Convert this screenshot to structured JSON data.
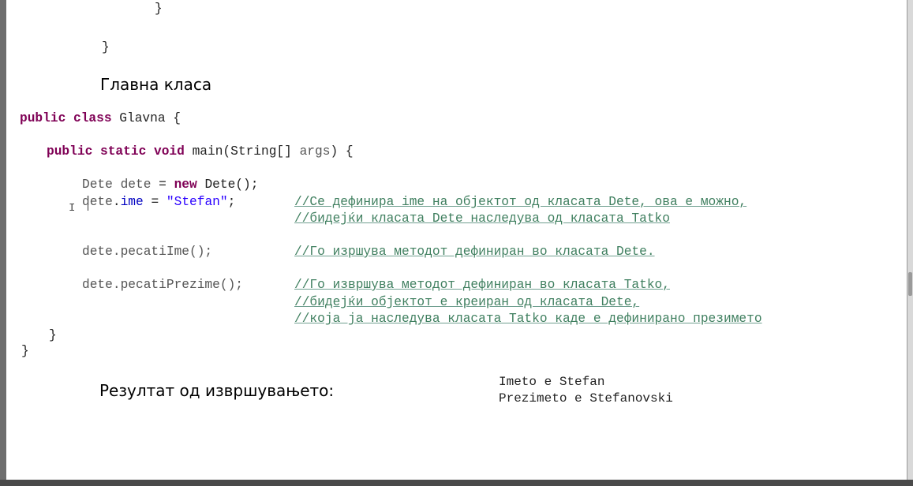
{
  "code_top": {
    "brace_inner": "}",
    "brace_outer": "}"
  },
  "heading_main": "Главна класа",
  "code": {
    "line1": {
      "kw": "public class",
      "rest": " Glavna {"
    },
    "line2": {
      "kw": "public static void",
      "rest": " main(String[] ",
      "arg": "args",
      "end": ") {"
    },
    "line3": {
      "type": "Dete ",
      "var": "dete",
      "eq": " = ",
      "kw": "new",
      "rest": " Dete();"
    },
    "line4": {
      "var": "dete",
      "dot": ".",
      "field": "ime",
      "eq": " = ",
      "str": "\"Stefan\"",
      "semi": ";"
    },
    "comment4": "//Се дефинира ime на објектот од класата Dete, ова е можно,",
    "comment5": "//бидејќи класата Dete наследува од класата Tatko",
    "line6": {
      "var": "dete",
      "rest": ".pecatiIme();"
    },
    "comment6": "//Го изршува методот дефиниран во класата Dete.",
    "line7": {
      "var": "dete",
      "rest": ".pecatiPrezime();"
    },
    "comment7": "//Го извршува методот дефиниран во класата Tatko,",
    "comment8": "//бидејќи објектот е креиран од класата Dete,",
    "comment9": "//која ја наследува класата Tatko каде е дефинирано презимето",
    "close_inner": "}",
    "close_outer": "}"
  },
  "heading_result": "Резултат од извршувањето:",
  "output": {
    "line1": "Imeto e Stefan",
    "line2": "Prezimeto e Stefanovski"
  },
  "icons": {
    "text_cursor": "I"
  }
}
